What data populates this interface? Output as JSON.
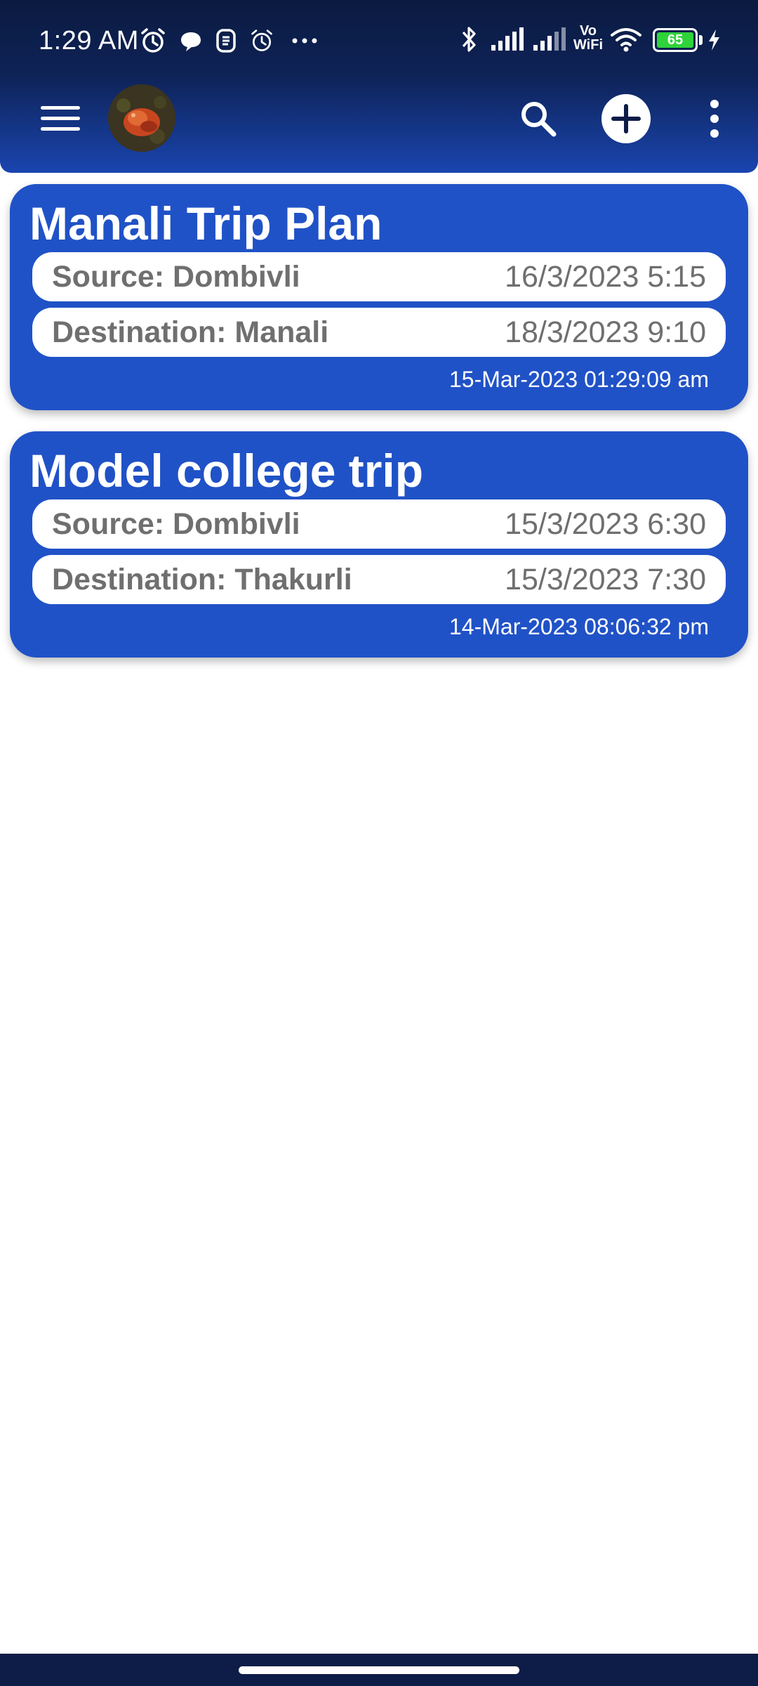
{
  "status_bar": {
    "time": "1:29 AM",
    "left_icons": [
      "alarm-icon",
      "chat-bubble-icon",
      "app-notification-icon",
      "alarm-icon",
      "more-notifications-icon"
    ],
    "right_icons": [
      "bluetooth-icon",
      "signal-icon",
      "signal-icon",
      "vowifi-icon",
      "wifi-icon",
      "battery-icon",
      "charging-icon"
    ],
    "vowifi_label_top": "Vo",
    "vowifi_label_bottom": "WiFi",
    "battery_percent": "65"
  },
  "app_bar": {
    "menu_icon": "hamburger-menu-icon",
    "avatar_icon": "profile-avatar",
    "actions": [
      "search-icon",
      "add-icon",
      "more-vert-icon"
    ]
  },
  "trips": [
    {
      "title": "Manali Trip Plan",
      "source_label": "Source: Dombivli",
      "source_time": "16/3/2023 5:15",
      "destination_label": "Destination: Manali",
      "destination_time": "18/3/2023 9:10",
      "created": "15-Mar-2023 01:29:09 am"
    },
    {
      "title": "Model college trip",
      "source_label": "Source: Dombivli",
      "source_time": "15/3/2023 6:30",
      "destination_label": "Destination: Thakurli",
      "destination_time": "15/3/2023 7:30",
      "created": "14-Mar-2023 08:06:32 pm"
    }
  ],
  "colors": {
    "card_background": "#2052c7",
    "appbar_dark": "#0b1a40",
    "pill_text": "#6f6f6f",
    "battery_fill": "#2fd33a"
  }
}
